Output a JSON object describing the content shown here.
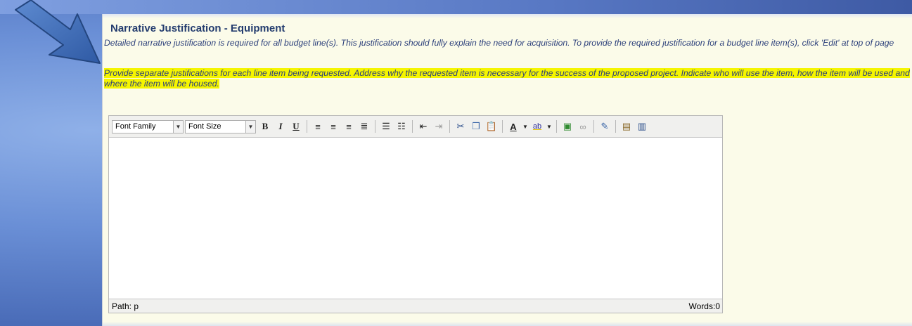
{
  "section": {
    "title": "Narrative Justification - Equipment",
    "instruction": "Detailed narrative justification is required for all budget line(s). This justification should fully explain the need for acquisition. To provide the required justification for a budget line item(s), click 'Edit' at top of page",
    "highlighted_instruction": "Provide separate justifications for each line item being requested. Address why the requested item is necessary for the success of the proposed project. Indicate who will use the item, how the item will be used and where the item will be housed."
  },
  "editor": {
    "font_family_label": "Font Family",
    "font_size_label": "Font Size",
    "status_path": "Path: p",
    "word_count": "Words:0",
    "content": ""
  },
  "colors": {
    "panel_bg": "#fbfbe9",
    "title": "#233c6e",
    "text": "#2b3f7a",
    "highlight": "#f5f500",
    "arrow": "#3a6ab8"
  },
  "icons": [
    "bold-icon",
    "italic-icon",
    "underline-icon",
    "align-left-icon",
    "align-center-icon",
    "align-right-icon",
    "align-justify-icon",
    "bullet-list-icon",
    "numbered-list-icon",
    "outdent-icon",
    "indent-icon",
    "cut-icon",
    "copy-icon",
    "paste-icon",
    "font-color-icon",
    "highlight-color-icon",
    "image-icon",
    "link-icon",
    "edit-html-icon",
    "paste-text-icon",
    "paste-word-icon"
  ]
}
